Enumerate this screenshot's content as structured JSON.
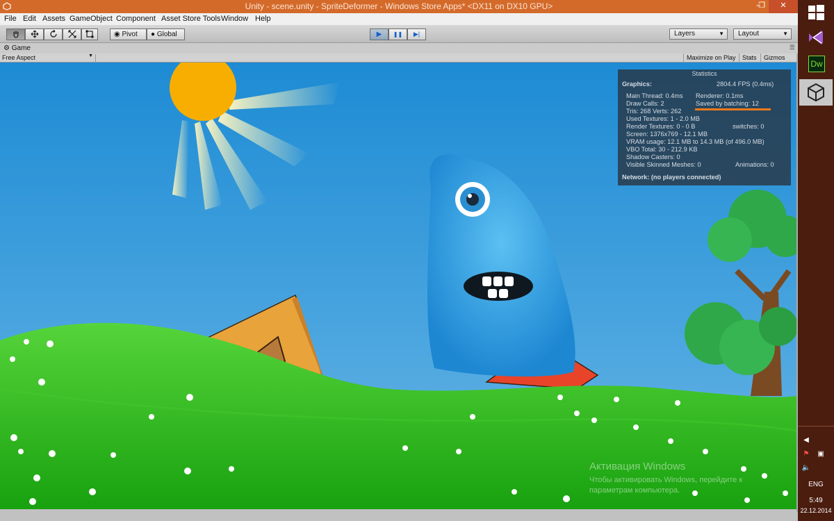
{
  "window": {
    "title": "Unity - scene.unity - SpriteDeformer - Windows Store Apps* <DX11 on DX10 GPU>",
    "minimize": "–",
    "maximize": "❐",
    "close": "✕"
  },
  "menu": [
    "File",
    "Edit",
    "Assets",
    "GameObject",
    "Component",
    "Asset Store Tools",
    "Window",
    "Help"
  ],
  "toolbar": {
    "tools": [
      "hand-icon",
      "move-icon",
      "rotate-icon",
      "scale-icon",
      "rect-icon"
    ],
    "pivot": "Pivot",
    "global": "Global",
    "play": "▶",
    "pause": "❚❚",
    "step": "▶|",
    "layers": "Layers",
    "layout": "Layout"
  },
  "game": {
    "tab": "Game",
    "aspect": "Free Aspect",
    "maximize": "Maximize on Play",
    "stats": "Stats",
    "gizmos": "Gizmos"
  },
  "statistics": {
    "title": "Statistics",
    "graphics_label": "Graphics:",
    "fps": "2804.4 FPS (0.4ms)",
    "main_thread": "Main Thread: 0.4ms",
    "renderer": "Renderer: 0.1ms",
    "draw_calls": "Draw Calls: 2",
    "saved_batching": "Saved by batching: 12",
    "tris": "Tris: 268  Verts: 262",
    "used_textures": "Used Textures: 1 - 2.0 MB",
    "render_textures": "Render Textures: 0 - 0 B",
    "switches": "switches: 0",
    "screen": "Screen: 1376x769 - 12.1 MB",
    "vram": "VRAM usage: 12.1 MB to 14.3 MB (of 496.0 MB)",
    "vbo": "VBO Total: 30 - 212.9 KB",
    "shadow": "Shadow Casters: 0",
    "skinned": "Visible Skinned Meshes: 0",
    "animations": "Animations: 0",
    "network": "Network: (no players connected)"
  },
  "watermark": {
    "line1": "Активация Windows",
    "line2": "Чтобы активировать Windows, перейдите к параметрам компьютера."
  },
  "taskbar": {
    "apps": [
      "windows-icon",
      "visual-studio-icon",
      "dreamweaver-icon",
      "unity-icon"
    ],
    "dw_label": "Dw",
    "lang": "ENG",
    "time": "5:49",
    "date": "22.12.2014"
  },
  "colors": {
    "title_bar": "#d46a2a",
    "taskbar": "#4a1d0f",
    "sky_top": "#1f8fd6",
    "grass": "#2fb81f",
    "sun": "#f7ae00",
    "monster": "#39a7e8"
  }
}
